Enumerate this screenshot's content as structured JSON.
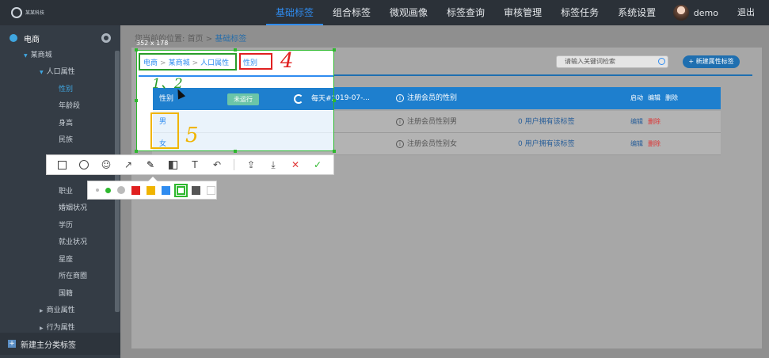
{
  "topbar": {
    "logo_text": "某某科技",
    "nav": [
      "基础标签",
      "组合标签",
      "微观画像",
      "标签查询",
      "审核管理",
      "标签任务",
      "系统设置"
    ],
    "active_nav": 0,
    "user_name": "demo",
    "logout": "退出"
  },
  "sidebar": {
    "root": "电商",
    "tree": [
      {
        "label": "某商城",
        "level": 1,
        "state": "open"
      },
      {
        "label": "人口属性",
        "level": 2,
        "state": "open"
      },
      {
        "label": "性别",
        "level": 3,
        "state": "selected"
      },
      {
        "label": "年龄段",
        "level": 3,
        "state": "leaf"
      },
      {
        "label": "身高",
        "level": 3,
        "state": "leaf"
      },
      {
        "label": "民族",
        "level": 3,
        "state": "leaf"
      },
      {
        "label": "职业",
        "level": 3,
        "state": "leaf"
      },
      {
        "label": "婚姻状况",
        "level": 3,
        "state": "leaf"
      },
      {
        "label": "学历",
        "level": 3,
        "state": "leaf"
      },
      {
        "label": "就业状况",
        "level": 3,
        "state": "leaf"
      },
      {
        "label": "星座",
        "level": 3,
        "state": "leaf"
      },
      {
        "label": "所在商圈",
        "level": 3,
        "state": "leaf"
      },
      {
        "label": "国籍",
        "level": 3,
        "state": "leaf"
      },
      {
        "label": "商业属性",
        "level": 2,
        "state": "closed"
      },
      {
        "label": "行为属性",
        "level": 2,
        "state": "closed"
      }
    ],
    "footer": "新建主分类标签"
  },
  "breadcrumb": {
    "prefix": "您当前的位置:",
    "home": "首页",
    "sep": ">",
    "current": "基础标签"
  },
  "search": {
    "placeholder": "请输入关键词检索"
  },
  "new_attr_button": "+ 新建属性标签",
  "table": {
    "header": {
      "name": "性别",
      "status": "未运行",
      "schedule": "每天#2019-07-...",
      "desc": "注册会员的性别",
      "actions": [
        "启动",
        "编辑",
        "删除"
      ]
    },
    "rows": [
      {
        "name": "男",
        "desc": "注册会员性别男",
        "count": "0 用户拥有该标签",
        "actions": [
          "编辑",
          "删除"
        ]
      },
      {
        "name": "女",
        "desc": "注册会员性别女",
        "count": "0 用户拥有该标签",
        "actions": [
          "编辑",
          "删除"
        ]
      }
    ]
  },
  "capture": {
    "size_label": "352 x 178",
    "crumb": [
      "电商",
      "某商城",
      "人口属性"
    ],
    "tag": "性别"
  },
  "annotations": {
    "num_12": "1、2",
    "num_4": "4",
    "num_5": "5"
  },
  "toolbar": {
    "tools": [
      "rectangle-icon",
      "ellipse-icon",
      "emoji-icon",
      "arrow-icon",
      "pen-icon",
      "mosaic-icon",
      "text-icon",
      "undo-icon",
      "share-icon",
      "download-icon",
      "cancel-icon",
      "confirm-icon"
    ],
    "glyphs": {
      "text": "T",
      "undo": "↶",
      "share": "⇪",
      "download": "⤓",
      "cancel": "✕",
      "confirm": "✓",
      "arrow": "↗",
      "pen": "✎",
      "emoji": "☺"
    }
  },
  "palette": {
    "sizes": [
      "small",
      "medium",
      "large"
    ],
    "colors": [
      "#e02020",
      "#f0b400",
      "#2f8cf0",
      "#2eb82e",
      "#555555",
      "#ffffff"
    ],
    "selected_color": "#2eb82e"
  }
}
